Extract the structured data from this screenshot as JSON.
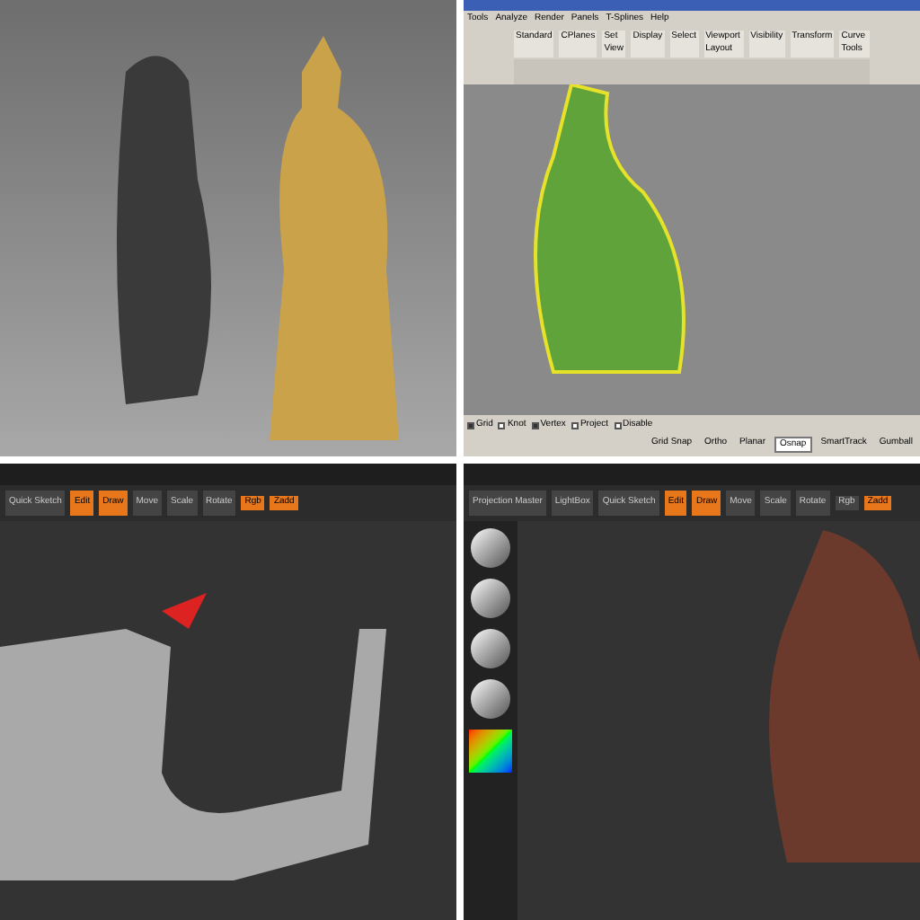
{
  "panels": [
    {
      "kind": "render"
    },
    {
      "kind": "rhino",
      "menu": [
        "Tools",
        "Analyze",
        "Render",
        "Panels",
        "T-Splines",
        "Help"
      ],
      "toolbar_tabs": [
        "Standard",
        "CPlanes",
        "Set View",
        "Display",
        "Select",
        "Viewport Layout",
        "Visibility",
        "Transform",
        "Curve Tools"
      ],
      "checkboxes": [
        {
          "label": "Grid",
          "checked": true
        },
        {
          "label": "Knot",
          "checked": false
        },
        {
          "label": "Vertex",
          "checked": true
        },
        {
          "label": "Project",
          "checked": false
        },
        {
          "label": "Disable",
          "checked": false
        }
      ],
      "status_tabs": [
        {
          "label": "Grid Snap",
          "selected": false
        },
        {
          "label": "Ortho",
          "selected": false
        },
        {
          "label": "Planar",
          "selected": false
        },
        {
          "label": "Osnap",
          "selected": true
        },
        {
          "label": "SmartTrack",
          "selected": false
        },
        {
          "label": "Gumball",
          "selected": false
        }
      ]
    },
    {
      "kind": "zbrush_mesh",
      "buttons": [
        {
          "label": "Quick Sketch",
          "selected": false
        },
        {
          "label": "Edit",
          "selected": true
        },
        {
          "label": "Draw",
          "selected": true
        },
        {
          "label": "Move",
          "selected": false
        },
        {
          "label": "Scale",
          "selected": false
        },
        {
          "label": "Rotate",
          "selected": false
        }
      ],
      "toggles": [
        {
          "label": "Rgb",
          "selected": true
        },
        {
          "label": "Zadd",
          "selected": true
        }
      ]
    },
    {
      "kind": "zbrush_sculpt",
      "buttons": [
        {
          "label": "Projection Master",
          "selected": false
        },
        {
          "label": "LightBox",
          "selected": false
        },
        {
          "label": "Quick Sketch",
          "selected": false
        },
        {
          "label": "Edit",
          "selected": true
        },
        {
          "label": "Draw",
          "selected": true
        },
        {
          "label": "Move",
          "selected": false
        },
        {
          "label": "Scale",
          "selected": false
        },
        {
          "label": "Rotate",
          "selected": false
        }
      ],
      "toggles": [
        {
          "label": "Rgb",
          "selected": false
        },
        {
          "label": "Zadd",
          "selected": true
        }
      ]
    }
  ]
}
